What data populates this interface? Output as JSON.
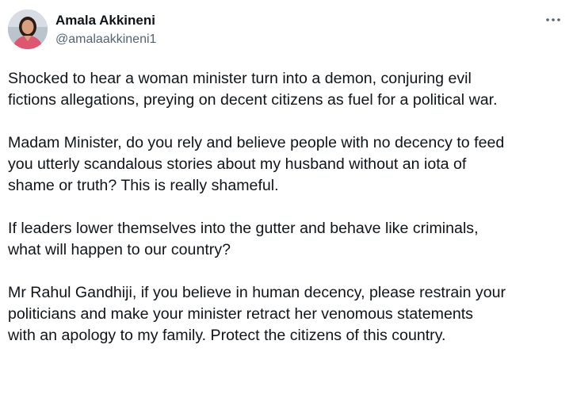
{
  "author": {
    "display_name": "Amala Akkineni",
    "handle": "@amalaakkineni1",
    "avatar_icon": "profile-photo"
  },
  "menu": {
    "icon": "more-horizontal-icon"
  },
  "tweet": {
    "paragraphs": [
      "Shocked to hear a woman minister turn into a demon, conjuring evil\nfictions allegations, preying on decent citizens as fuel for a political war.",
      "Madam Minister, do you rely and believe people with no decency to feed\nyou utterly scandalous stories about my husband without an iota of\nshame or truth? This is really shameful.",
      "If leaders lower themselves into the gutter and behave like criminals,\nwhat will happen to our country?",
      "Mr Rahul Gandhiji, if you believe in human decency, please restrain your\npoliticians and make your minister retract her venomous statements\nwith an apology to my family. Protect the citizens of this country."
    ]
  },
  "colors": {
    "text": "#0f1419",
    "secondary": "#536471",
    "background": "#ffffff"
  }
}
